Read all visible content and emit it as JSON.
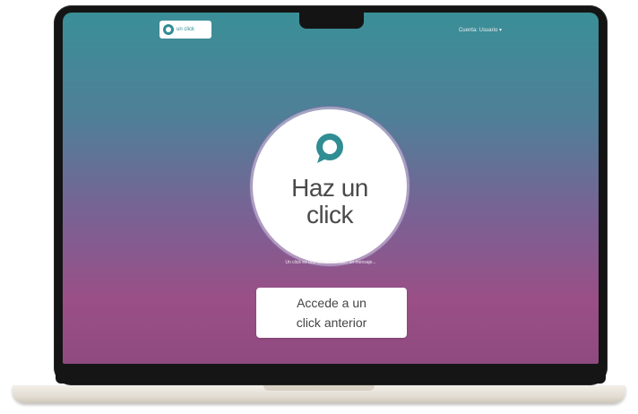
{
  "header": {
    "logo_text": "un click",
    "account_label": "Cuenta: Usuario ▾"
  },
  "hero": {
    "title_line1": "Haz un",
    "title_line2": "click",
    "subtitle": "Un click es una idea, una frase, un mensaje..."
  },
  "cta": {
    "line1": "Accede a un",
    "line2": "click anterior"
  },
  "colors": {
    "teal": "#3a8f97",
    "magenta": "#9a4f86"
  },
  "icons": {
    "logo": "speech-bubble-logo-icon",
    "hero": "speech-bubble-icon"
  }
}
